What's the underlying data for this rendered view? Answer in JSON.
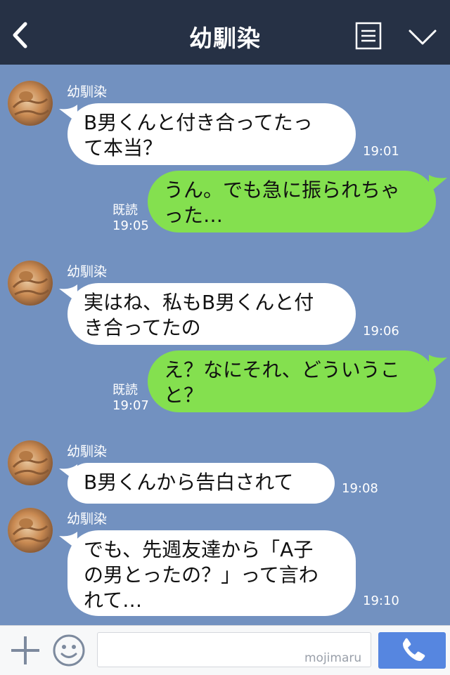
{
  "header": {
    "title": "幼馴染",
    "back_icon": "chevron-left-icon",
    "menu_icon": "list-menu-icon",
    "expand_icon": "chevron-down-icon",
    "background": "#263145"
  },
  "chat": {
    "background": "#7291c0",
    "messages": [
      {
        "side": "left",
        "sender": "幼馴染",
        "lines": [
          "B男くんと付き合ってたっ",
          "て本当？"
        ],
        "time": "19:01"
      },
      {
        "side": "right",
        "read": "既読",
        "lines": [
          "うん。でも急に振られちゃ",
          "った…"
        ],
        "time": "19:05"
      },
      {
        "side": "left",
        "sender": "幼馴染",
        "lines": [
          "実はね、私もB男くんと付",
          "き合ってたの"
        ],
        "time": "19:06"
      },
      {
        "side": "right",
        "read": "既読",
        "lines": [
          "え？なにそれ、どういうこ",
          "と？"
        ],
        "time": "19:07"
      },
      {
        "side": "left",
        "sender": "幼馴染",
        "lines": [
          "B男くんから告白されて"
        ],
        "time": "19:08"
      },
      {
        "side": "left",
        "sender": "幼馴染",
        "lines": [
          "でも、先週友達から「A子",
          "の男とったの？」って言わ",
          "れて…"
        ],
        "time": "19:10"
      }
    ],
    "bubble_colors": {
      "incoming": "#ffffff",
      "outgoing": "#84e04f"
    }
  },
  "input_bar": {
    "plus_icon": "plus-icon",
    "emoji_icon": "smiley-icon",
    "input_value": "",
    "watermark": "mojimaru",
    "call_icon": "phone-icon",
    "call_color": "#5686e0"
  }
}
